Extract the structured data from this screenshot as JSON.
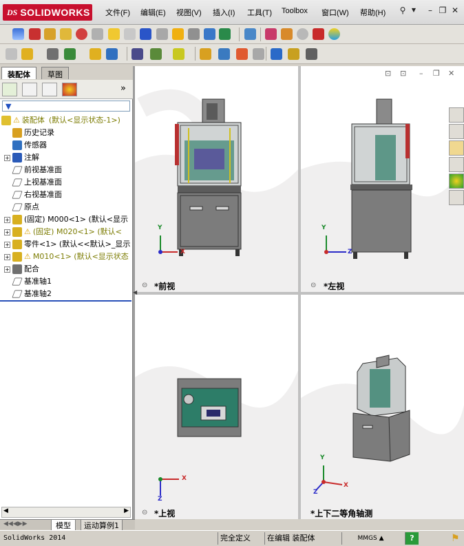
{
  "app": {
    "brand": "SOLIDWORKS",
    "brand_mark": "DS"
  },
  "menu": {
    "items": [
      "文件(F)",
      "编辑(E)",
      "视图(V)",
      "插入(I)",
      "工具(T)",
      "Toolbox",
      "窗口(W)",
      "帮助(H)"
    ]
  },
  "left_panel": {
    "tabs": [
      "装配体",
      "草图"
    ],
    "expand_label": "»",
    "filter_icon": "filter-icon",
    "tree": [
      {
        "label": "装配体",
        "suffix": "(默认<显示状态-1>)",
        "icon": "assembly-icon",
        "warn": true
      },
      {
        "label": "历史记录",
        "icon": "history-icon"
      },
      {
        "label": "传感器",
        "icon": "sensor-icon"
      },
      {
        "label": "注解",
        "icon": "annotation-icon",
        "expand": "+"
      },
      {
        "label": "前视基准面",
        "icon": "plane-icon"
      },
      {
        "label": "上视基准面",
        "icon": "plane-icon"
      },
      {
        "label": "右视基准面",
        "icon": "plane-icon"
      },
      {
        "label": "原点",
        "icon": "origin-icon"
      },
      {
        "label": "(固定) M000<1> (默认<显示",
        "icon": "part-icon",
        "expand": "+"
      },
      {
        "label": "(固定) M020<1> (默认<",
        "icon": "part-icon",
        "expand": "+",
        "warn": true
      },
      {
        "label": "零件<1> (默认<<默认>_显示",
        "icon": "part-icon",
        "expand": "+"
      },
      {
        "label": "M010<1> (默认<显示状态",
        "icon": "part-icon",
        "expand": "+",
        "warn": true
      },
      {
        "label": "配合",
        "icon": "mate-icon",
        "expand": "+"
      },
      {
        "label": "基准轴1",
        "icon": "axis-icon"
      },
      {
        "label": "基准轴2",
        "icon": "axis-icon"
      }
    ],
    "bottom_tabs": [
      "模型",
      "运动算例1"
    ]
  },
  "viewports": {
    "front": {
      "label": "*前视"
    },
    "left": {
      "label": "*左视"
    },
    "top": {
      "label": "*上视"
    },
    "iso": {
      "label": "*上下二等角轴测"
    }
  },
  "axes": {
    "x": "X",
    "y": "Y",
    "z": "Z"
  },
  "status": {
    "app_version": "SolidWorks 2014",
    "defined": "完全定义",
    "editing": "在编辑 装配体",
    "units": "MMGS",
    "help": "?"
  },
  "colors": {
    "accent": "#c8102e",
    "frame": "#6a6a6a",
    "panel": "#1a7a60",
    "cabinet": "#7c7c7c"
  }
}
